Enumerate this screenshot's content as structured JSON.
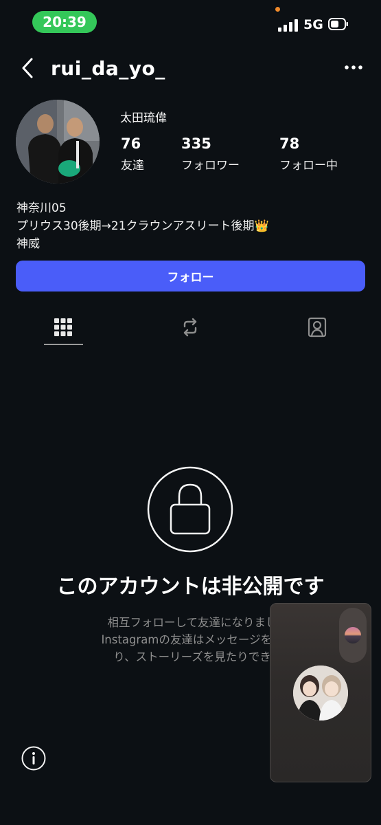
{
  "status_bar": {
    "time": "20:39",
    "network": "5G"
  },
  "header": {
    "username": "rui_da_yo_"
  },
  "profile": {
    "full_name": "太田琉偉",
    "stats": [
      {
        "count": "76",
        "label": "友達"
      },
      {
        "count": "335",
        "label": "フォロワー"
      },
      {
        "count": "78",
        "label": "フォロー中"
      }
    ],
    "bio": [
      "神奈川05",
      "プリウス30後期→21クラウンアスリート後期👑",
      "神威"
    ]
  },
  "follow_button": {
    "label": "フォロー"
  },
  "tabs": [
    {
      "icon": "grid-icon",
      "active": true
    },
    {
      "icon": "reels-icon",
      "active": false
    },
    {
      "icon": "tagged-icon",
      "active": false
    }
  ],
  "private": {
    "title": "このアカウントは非公開です",
    "description": [
      "相互フォローして友達になりまし",
      "Instagramの友達はメッセージをや",
      "り、ストーリーズを見たりでき"
    ]
  },
  "colors": {
    "background": "#0c1014",
    "accent": "#4a5df9",
    "time_pill": "#34c759",
    "secondary_text": "#8e8e8e"
  }
}
